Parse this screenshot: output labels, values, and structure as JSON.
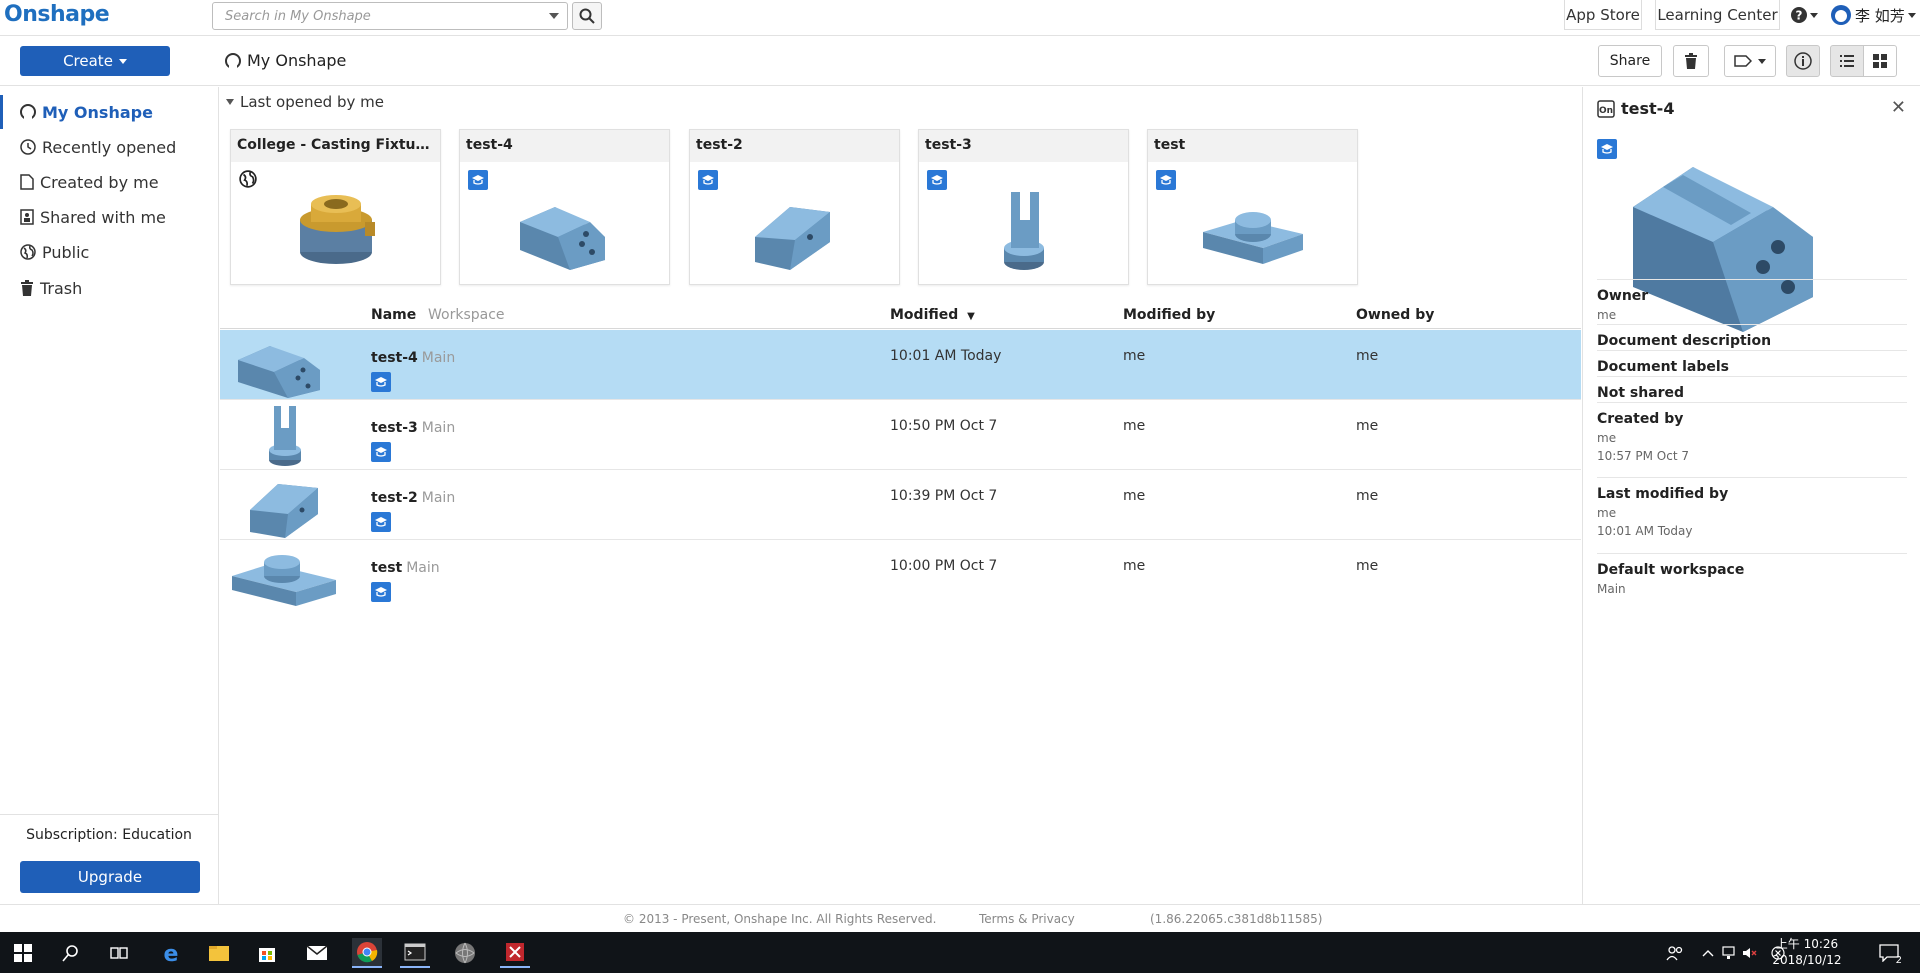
{
  "app": {
    "logo": "Onshape"
  },
  "search": {
    "placeholder": "Search in My Onshape"
  },
  "topbar": {
    "app_store": "App Store",
    "learning_center": "Learning Center",
    "user_name": "李 如芳"
  },
  "toolbar": {
    "create_label": "Create",
    "breadcrumb": "My Onshape",
    "share_label": "Share"
  },
  "sidebar": {
    "items": [
      {
        "label": "My Onshape",
        "icon": "user-icon"
      },
      {
        "label": "Recently opened",
        "icon": "clock-icon"
      },
      {
        "label": "Created by me",
        "icon": "document-icon"
      },
      {
        "label": "Shared with me",
        "icon": "shared-icon"
      },
      {
        "label": "Public",
        "icon": "globe-icon"
      },
      {
        "label": "Trash",
        "icon": "trash-icon"
      }
    ],
    "subscription": "Subscription: Education",
    "upgrade_label": "Upgrade"
  },
  "recent": {
    "heading": "Last opened by me",
    "cards": [
      {
        "title": "College - Casting Fixture De...",
        "icon": "globe-icon"
      },
      {
        "title": "test-4",
        "icon": "education-icon"
      },
      {
        "title": "test-2",
        "icon": "education-icon"
      },
      {
        "title": "test-3",
        "icon": "education-icon"
      },
      {
        "title": "test",
        "icon": "education-icon"
      }
    ]
  },
  "table": {
    "headers": {
      "name": "Name",
      "workspace": "Workspace",
      "modified": "Modified",
      "modified_by": "Modified by",
      "owned_by": "Owned by"
    },
    "rows": [
      {
        "name": "test-4",
        "workspace": "Main",
        "modified": "10:01 AM Today",
        "modified_by": "me",
        "owned_by": "me"
      },
      {
        "name": "test-3",
        "workspace": "Main",
        "modified": "10:50 PM Oct 7",
        "modified_by": "me",
        "owned_by": "me"
      },
      {
        "name": "test-2",
        "workspace": "Main",
        "modified": "10:39 PM Oct 7",
        "modified_by": "me",
        "owned_by": "me"
      },
      {
        "name": "test",
        "workspace": "Main",
        "modified": "10:00 PM Oct 7",
        "modified_by": "me",
        "owned_by": "me"
      }
    ]
  },
  "info": {
    "title": "test-4",
    "fields": [
      {
        "label": "Owner",
        "value": "me"
      },
      {
        "label": "Document description",
        "value": ""
      },
      {
        "label": "Document labels",
        "value": ""
      },
      {
        "label": "Not shared",
        "value": ""
      },
      {
        "label": "Created by",
        "value": "me",
        "value2": "10:57 PM Oct 7"
      },
      {
        "label": "Last modified by",
        "value": "me",
        "value2": "10:01 AM Today"
      },
      {
        "label": "Default workspace",
        "value": "Main"
      }
    ]
  },
  "footer": {
    "copyright": "© 2013 - Present, Onshape Inc. All Rights Reserved.",
    "terms": "Terms & Privacy",
    "version": "(1.86.22065.c381d8b11585)"
  },
  "taskbar": {
    "time_label": "上午 10:26",
    "date": "2018/10/12",
    "notifications": "2"
  },
  "colors": {
    "accent": "#1f5fb8",
    "selected_row": "#b5dcf4",
    "part": "#6b9cc4"
  }
}
